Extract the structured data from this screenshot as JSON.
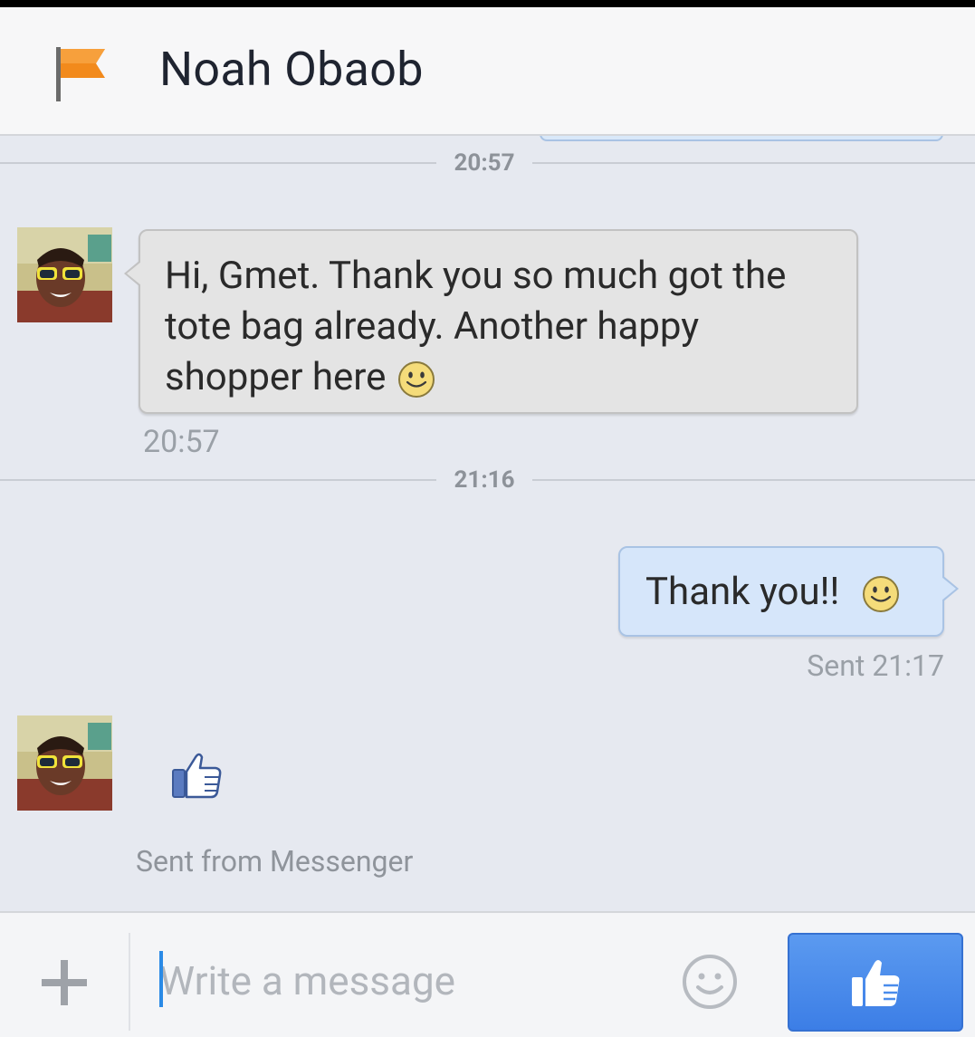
{
  "header": {
    "title": "Noah Obaob",
    "icon": "flag-icon"
  },
  "conversation": {
    "dividers": [
      {
        "time": "20:57"
      },
      {
        "time": "21:16"
      }
    ],
    "incoming": {
      "text": "Hi, Gmet. Thank you so much got the tote bag already. Another happy shopper here",
      "emoji": "smiley-icon",
      "timestamp": "20:57"
    },
    "outgoing": {
      "text": "Thank you!!",
      "emoji": "smiley-icon",
      "status": "Sent 21:17"
    },
    "like_message": {
      "icon": "thumbs-up-icon",
      "footer": "Sent from Messenger"
    }
  },
  "composer": {
    "placeholder": "Write a message",
    "value": "",
    "attach_icon": "plus-icon",
    "emoji_icon": "smiley-icon",
    "send_icon": "thumbs-up-icon"
  },
  "colors": {
    "accent": "#4a8cec",
    "incoming_bubble": "#e4e4e4",
    "outgoing_bubble": "#d6e6fa",
    "background": "#e6e9f0",
    "flag": "#f28a1c"
  }
}
